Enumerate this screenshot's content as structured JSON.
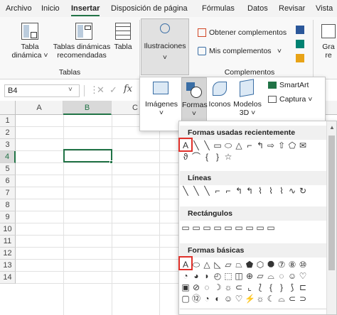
{
  "tabs": [
    "Archivo",
    "Inicio",
    "Insertar",
    "Disposición de página",
    "Fórmulas",
    "Datos",
    "Revisar",
    "Vista"
  ],
  "active_tab": "Insertar",
  "ribbon": {
    "tabla_dinamica": "Tabla dinámica",
    "tablas_dinamicas_recomendadas": "Tablas dinámicas recomendadas",
    "tabla": "Tabla",
    "group_tablas": "Tablas",
    "ilustraciones": "Ilustraciones",
    "obtener_complementos": "Obtener complementos",
    "mis_complementos": "Mis complementos",
    "group_complementos": "Complementos",
    "gra": "Gra",
    "re": "re"
  },
  "formula_bar": {
    "name_box": "B4",
    "fx": "fx"
  },
  "columns": [
    "A",
    "B",
    "C"
  ],
  "selected_column": "B",
  "rows": [
    "1",
    "2",
    "3",
    "4",
    "5",
    "6",
    "7",
    "8",
    "9",
    "10",
    "11",
    "12",
    "13",
    "14"
  ],
  "selected_row": "4",
  "illustrations_menu": {
    "imagenes": "Imágenes",
    "formas": "Formas",
    "iconos": "Iconos",
    "modelos_3d": "Modelos 3D",
    "smartart": "SmartArt",
    "captura": "Captura"
  },
  "shapes_menu": {
    "recientes": "Formas usadas recientemente",
    "lineas": "Líneas",
    "rectangulos": "Rectángulos",
    "basicas": "Formas básicas",
    "textbox_glyph": "A"
  },
  "colors": {
    "accent": "#217346",
    "highlight": "#e0302a"
  }
}
